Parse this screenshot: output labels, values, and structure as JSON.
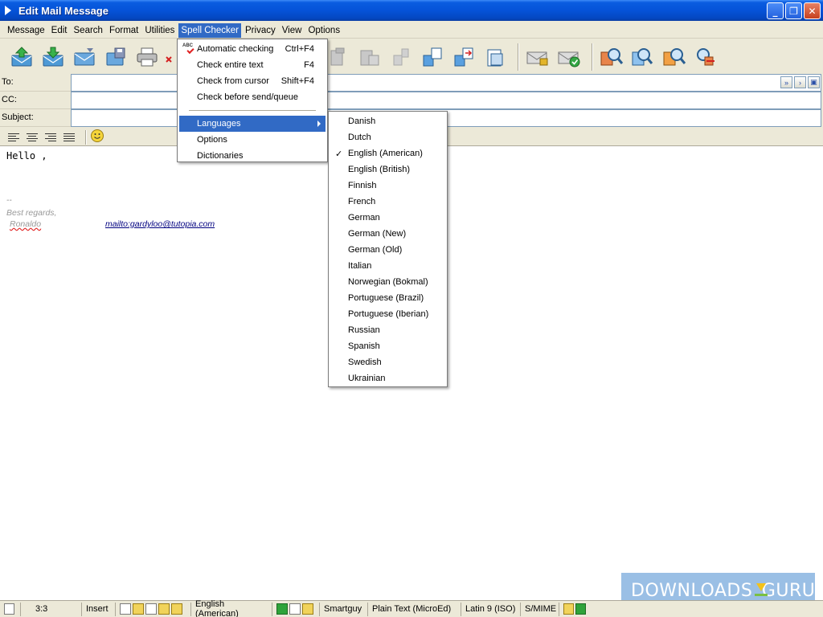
{
  "window": {
    "title": "Edit Mail Message",
    "min": "_",
    "max": "❐",
    "close": "✕"
  },
  "menubar": [
    "Message",
    "Edit",
    "Search",
    "Format",
    "Utilities",
    "Spell Checker",
    "Privacy",
    "View",
    "Options"
  ],
  "toolbar": {
    "icons": [
      "send-icon",
      "queue-icon",
      "save-draft-icon",
      "save-icon",
      "print-icon",
      "delete-icon",
      "cut-icon",
      "copy-icon",
      "paste-icon",
      "paste-special-icon",
      "attach-icon",
      "insert-icon",
      "sign-icon",
      "encrypt-icon",
      "find-icon",
      "find-next-icon",
      "replace-icon",
      "replace-next-icon"
    ]
  },
  "headers": {
    "to_label": "To:",
    "cc_label": "CC:",
    "subject_label": "Subject:"
  },
  "editor": {
    "greeting": "Hello ,",
    "sig_dash": "--",
    "regards": "Best regards,",
    "name": "Ronaldo",
    "mailto": "mailto:gardyloo@tutopia.com"
  },
  "spell_menu": {
    "items": [
      {
        "label": "Automatic checking",
        "shortcut": "Ctrl+F4"
      },
      {
        "label": "Check entire text",
        "shortcut": "F4"
      },
      {
        "label": "Check from cursor",
        "shortcut": "Shift+F4"
      },
      {
        "label": "Check before send/queue",
        "shortcut": ""
      }
    ],
    "languages": "Languages",
    "options": "Options",
    "dictionaries": "Dictionaries"
  },
  "languages": {
    "items": [
      "Danish",
      "Dutch",
      "English (American)",
      "English (British)",
      "Finnish",
      "French",
      "German",
      "German (New)",
      "German (Old)",
      "Italian",
      "Norwegian (Bokmal)",
      "Portuguese (Brazil)",
      "Portuguese (Iberian)",
      "Russian",
      "Spanish",
      "Swedish",
      "Ukrainian"
    ],
    "selected": "English (American)",
    "check_mark": "✓"
  },
  "status": {
    "position": "3:3",
    "mode": "Insert",
    "language": "English (American)",
    "account": "Smartguy",
    "format": "Plain Text (MicroEd)",
    "charset": "Latin 9 (ISO)",
    "security": "S/MIME"
  },
  "watermark": {
    "left": "DOWNLOADS",
    "right": ".GURU"
  },
  "colors": {
    "title_blue": "#0553d8",
    "highlight": "#316ac5",
    "chrome": "#ece9d8"
  }
}
